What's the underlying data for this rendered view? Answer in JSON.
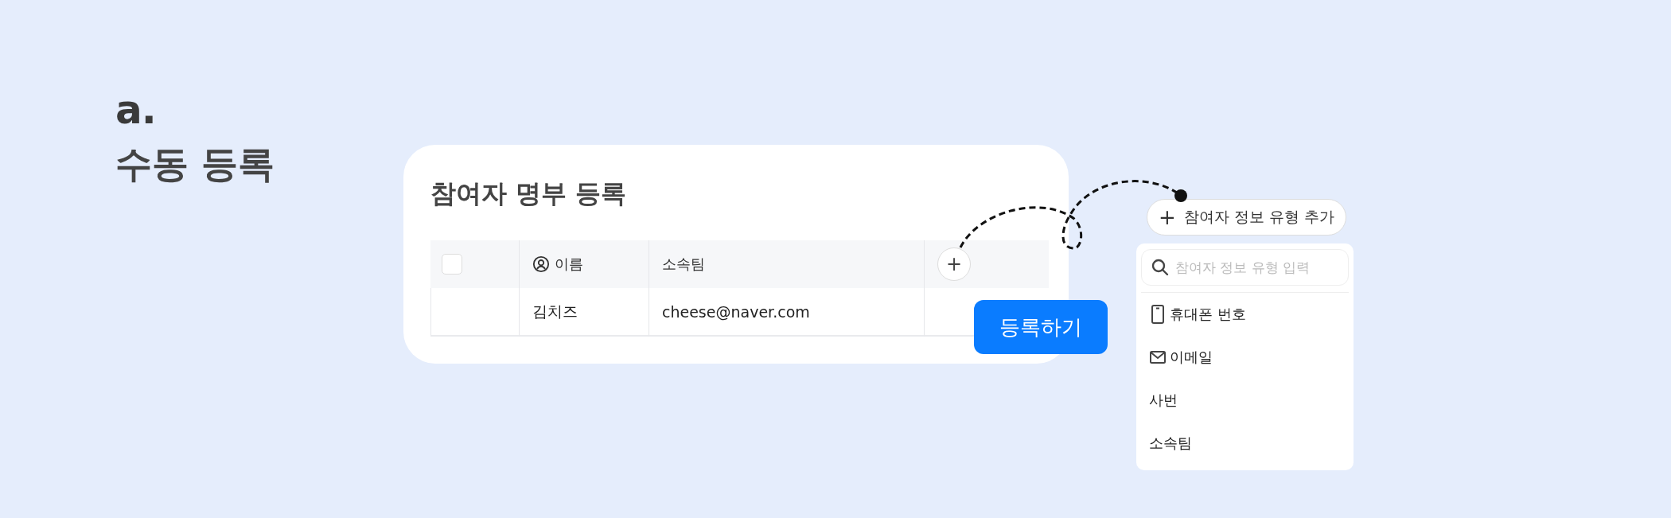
{
  "heading": {
    "mark": "a.",
    "title": "수동 등록"
  },
  "card": {
    "title": "참여자 명부 등록",
    "columns": [
      {
        "kind": "checkbox",
        "checked": false
      },
      {
        "kind": "person",
        "label": "이름"
      },
      {
        "kind": "text",
        "label": "소속팀"
      },
      {
        "kind": "add",
        "label": "+"
      }
    ],
    "rows": [
      {
        "cells": [
          "",
          "김치즈",
          "cheese@naver.com",
          ""
        ]
      }
    ],
    "submit": "등록하기"
  },
  "add_type_button": {
    "icon": "+",
    "label": "참여자 정보 유형 추가"
  },
  "dropdown": {
    "search": {
      "placeholder": "참여자 정보 유형 입력"
    },
    "items": [
      {
        "kind": "phone",
        "label": "휴대폰 번호"
      },
      {
        "kind": "email",
        "label": "이메일"
      },
      {
        "kind": "plain",
        "label": "사번"
      },
      {
        "kind": "plain",
        "label": "소속팀"
      }
    ]
  }
}
